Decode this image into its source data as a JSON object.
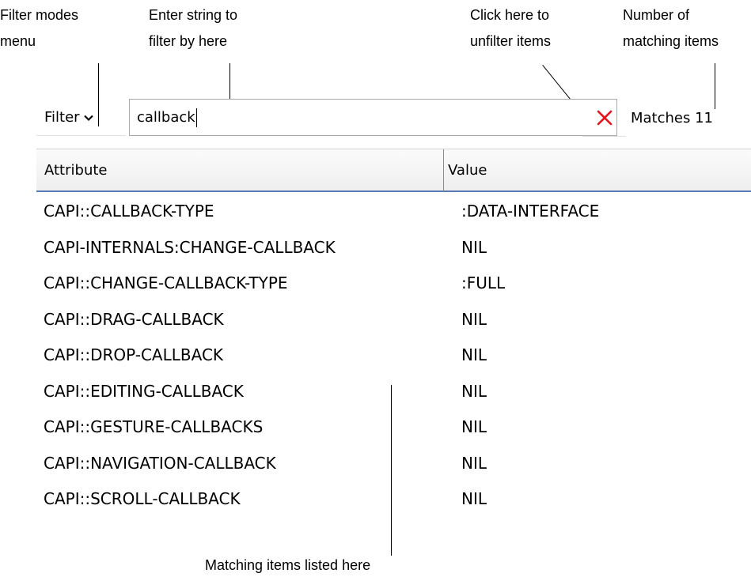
{
  "annotations": {
    "filter_modes": [
      "Filter modes",
      "menu"
    ],
    "enter_string": [
      "Enter string to",
      "filter by here"
    ],
    "unfilter": [
      "Click here to",
      "unfilter items"
    ],
    "num_matching": [
      "Number of",
      "matching items"
    ],
    "matching_listed": "Matching items listed here"
  },
  "toolbar": {
    "filter_label": "Filter",
    "search_value": "callback",
    "matches_label": "Matches 11"
  },
  "table": {
    "headers": [
      "Attribute",
      "Value"
    ],
    "rows": [
      {
        "attribute": "CAPI::CALLBACK-TYPE",
        "value": ":DATA-INTERFACE"
      },
      {
        "attribute": "CAPI-INTERNALS:CHANGE-CALLBACK",
        "value": "NIL"
      },
      {
        "attribute": "CAPI::CHANGE-CALLBACK-TYPE",
        "value": ":FULL"
      },
      {
        "attribute": "CAPI::DRAG-CALLBACK",
        "value": "NIL"
      },
      {
        "attribute": "CAPI::DROP-CALLBACK",
        "value": "NIL"
      },
      {
        "attribute": "CAPI::EDITING-CALLBACK",
        "value": "NIL"
      },
      {
        "attribute": "CAPI::GESTURE-CALLBACKS",
        "value": "NIL"
      },
      {
        "attribute": "CAPI::NAVIGATION-CALLBACK",
        "value": "NIL"
      },
      {
        "attribute": "CAPI::SCROLL-CALLBACK",
        "value": "NIL"
      }
    ]
  },
  "colors": {
    "clear_icon": "#e8141a",
    "header_underline": "#5a7ab5"
  },
  "icons": {
    "filter_dropdown": "chevron-down-icon",
    "clear": "close-icon"
  }
}
